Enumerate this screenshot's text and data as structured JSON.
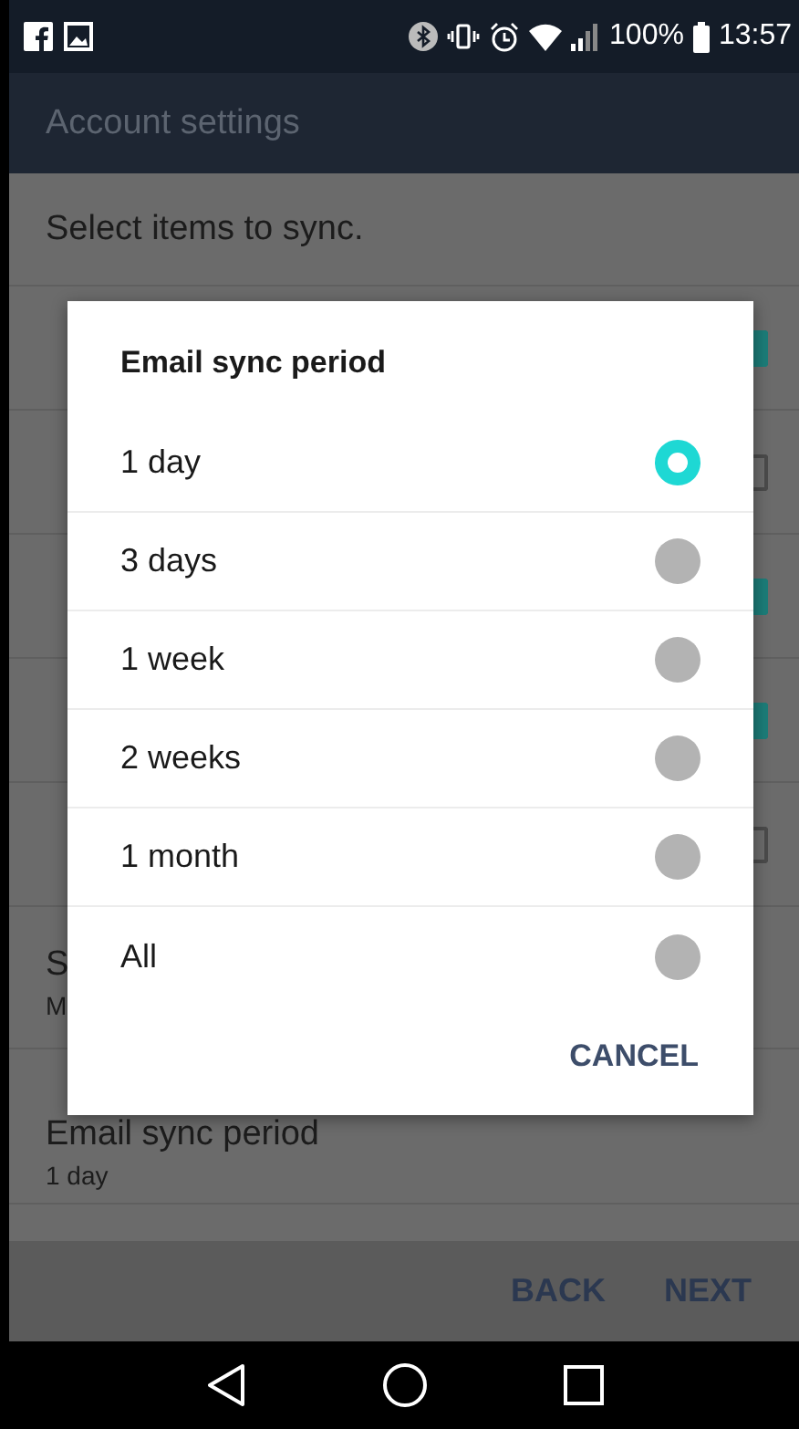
{
  "status_bar": {
    "battery": "100%",
    "time": "13:57"
  },
  "app_bar": {
    "title": "Account settings"
  },
  "settings": {
    "heading": "Select items to sync.",
    "sync_items": [
      {
        "checked": true
      },
      {
        "checked": false
      },
      {
        "checked": true
      },
      {
        "checked": true
      },
      {
        "checked": false
      }
    ],
    "partial_row": {
      "title": "S",
      "subtitle": "M"
    },
    "sync_period_row": {
      "title": "Email sync period",
      "value": "1 day"
    }
  },
  "dialog": {
    "title": "Email sync period",
    "options": [
      {
        "label": "1 day",
        "selected": true
      },
      {
        "label": "3 days",
        "selected": false
      },
      {
        "label": "1 week",
        "selected": false
      },
      {
        "label": "2 weeks",
        "selected": false
      },
      {
        "label": "1 month",
        "selected": false
      },
      {
        "label": "All",
        "selected": false
      }
    ],
    "cancel": "CANCEL"
  },
  "bottom_bar": {
    "back": "BACK",
    "next": "NEXT"
  }
}
